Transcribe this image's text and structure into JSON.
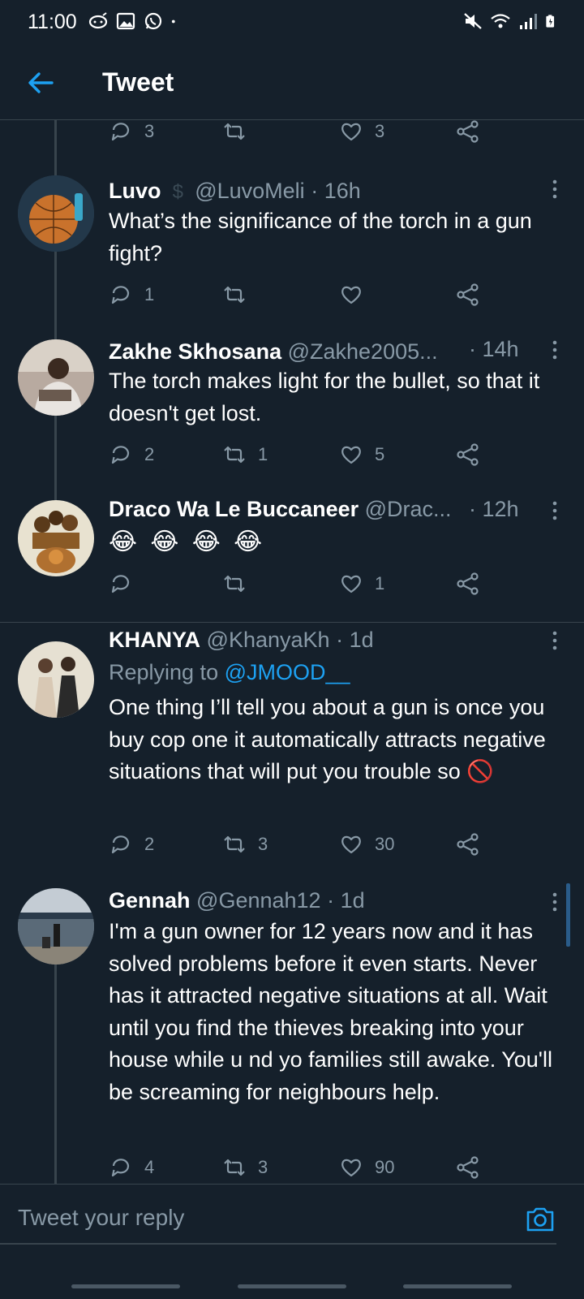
{
  "status_bar": {
    "time": "11:00",
    "left_icons": [
      "notification-icon",
      "gallery-icon",
      "whatsapp-icon",
      "dot-icon"
    ],
    "right_icons": [
      "mute-icon",
      "wifi-icon",
      "signal-icon",
      "battery-icon"
    ]
  },
  "header": {
    "title": "Tweet"
  },
  "colors": {
    "background": "#15202b",
    "accent": "#1da1f2",
    "muted": "#8899a6",
    "divider": "#38444d"
  },
  "top_actions": {
    "replies": "3",
    "retweets": "",
    "likes": "3"
  },
  "tweets": [
    {
      "name": "Luvo",
      "handle": "@LuvoMeli",
      "time": "· 16h",
      "text": "What’s the significance of the torch in a gun fight?",
      "replies": "1",
      "retweets": "",
      "likes": ""
    },
    {
      "name": "Zakhe Skhosana",
      "handle": "@Zakhe2005...",
      "time": "· 14h",
      "text": "The torch makes light for the bullet, so that it doesn't get lost.",
      "replies": "2",
      "retweets": "1",
      "likes": "5"
    },
    {
      "name": "Draco Wa Le Buccaneer",
      "handle": "@Drac...",
      "time": "· 12h",
      "text": "😂 😂 😂 😂",
      "replies": "",
      "retweets": "",
      "likes": "1"
    },
    {
      "name": "KHANYA",
      "handle": "@KhanyaKh",
      "time": "· 1d",
      "replying_prefix": "Replying to ",
      "replying_to": "@JMOOD__",
      "text": "One thing I’ll tell you about a gun is once you buy cop one it automatically attracts negative situations that will put you trouble so 🚫",
      "replies": "2",
      "retweets": "3",
      "likes": "30"
    },
    {
      "name": "Gennah",
      "handle": "@Gennah12",
      "time": "· 1d",
      "text": "I'm a gun owner for 12 years now and it has solved problems before it even starts. Never has it attracted negative situations at all. Wait until you find the thieves breaking into your house while u nd yo families still awake. You'll be screaming for neighbours help.",
      "replies": "4",
      "retweets": "3",
      "likes": "90"
    }
  ],
  "reply_bar": {
    "placeholder": "Tweet your reply"
  }
}
